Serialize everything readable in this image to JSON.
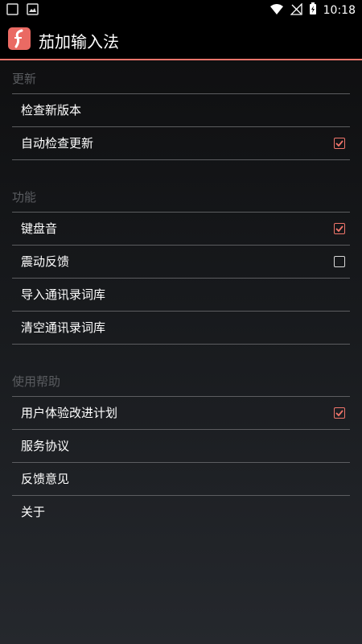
{
  "status_bar": {
    "time": "10:18",
    "left_icons": [
      "notification-icon",
      "image-icon"
    ],
    "right_icons": [
      "wifi-icon",
      "no-signal-icon",
      "battery-charging-icon"
    ]
  },
  "app_bar": {
    "title": "茄加输入法",
    "accent_color": "#f0756b"
  },
  "sections": [
    {
      "header": "更新",
      "items": [
        {
          "label": "检查新版本"
        },
        {
          "label": "自动检查更新",
          "checked": true
        }
      ]
    },
    {
      "header": "功能",
      "items": [
        {
          "label": "键盘音",
          "checked": true
        },
        {
          "label": "震动反馈",
          "checked": false
        },
        {
          "label": "导入通讯录词库"
        },
        {
          "label": "清空通讯录词库"
        }
      ]
    },
    {
      "header": "使用帮助",
      "items": [
        {
          "label": "用户体验改进计划",
          "checked": true
        },
        {
          "label": "服务协议"
        },
        {
          "label": "反馈意见"
        },
        {
          "label": "关于"
        }
      ]
    }
  ]
}
